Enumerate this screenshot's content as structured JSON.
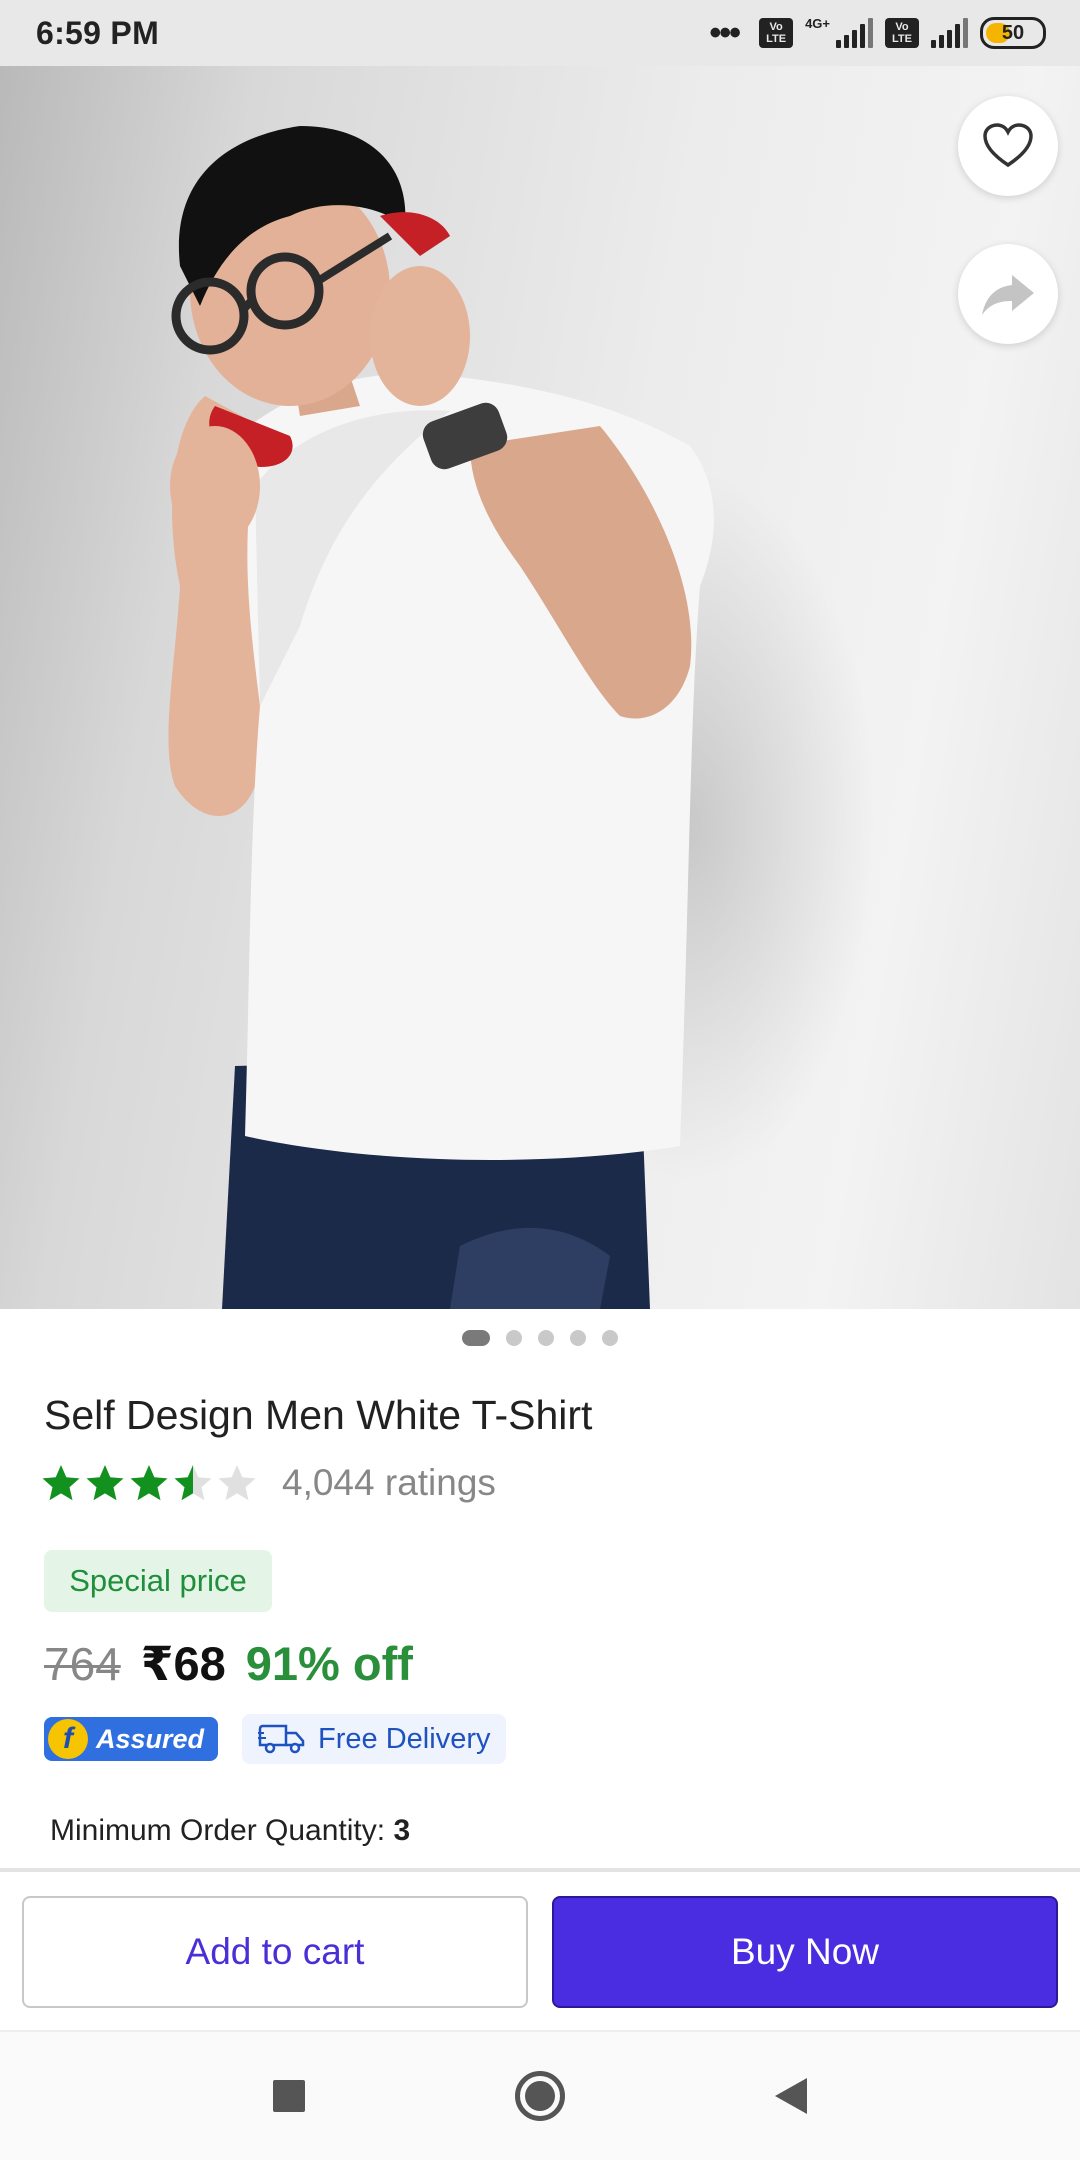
{
  "status_bar": {
    "time": "6:59 PM",
    "network_label": "4G+",
    "volte_1": "Vo LTE",
    "volte_2": "Vo LTE",
    "battery_level": "50",
    "battery_fraction": 0.5,
    "battery_color": "#f4b400"
  },
  "product_image": {
    "carousel_total": 5,
    "carousel_active_index": 0
  },
  "product": {
    "title": "Self Design Men White T-Shirt",
    "rating": 3.5,
    "max_rating": 5,
    "rating_count": "4,044 ratings",
    "special_badge": "Special price",
    "mrp": "764",
    "price": "₹68",
    "discount": "91% off",
    "assured_label": "Assured",
    "free_delivery_label": "Free Delivery",
    "moq_label": "Minimum Order Quantity:",
    "moq_value": "3"
  },
  "actions": {
    "add_to_cart": "Add to cart",
    "buy_now": "Buy Now"
  },
  "colors": {
    "primary": "#4a2de0",
    "star_green": "#13911f",
    "discount_green": "#2a8f3a"
  }
}
